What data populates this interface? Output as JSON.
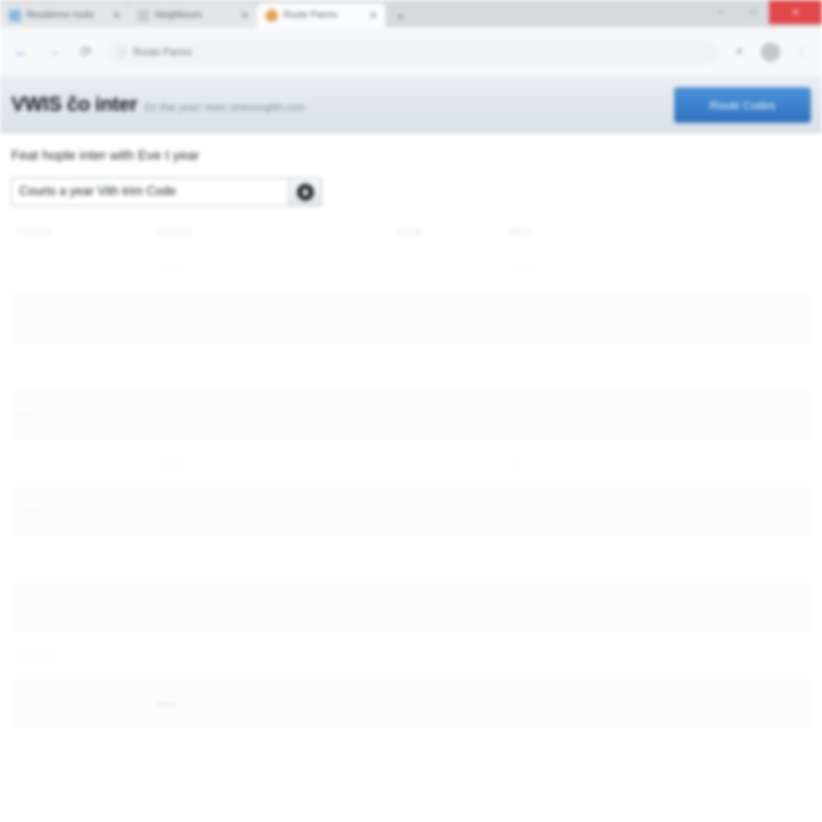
{
  "browser": {
    "tabs": [
      {
        "title": "Residence route",
        "favicon": "globe-favicon",
        "active": false
      },
      {
        "title": "Neighbours",
        "favicon": "page-favicon",
        "active": false
      },
      {
        "title": "Route Parms",
        "favicon": "orange-circle-favicon",
        "active": true
      }
    ],
    "new_tab_label": "+",
    "window_controls": {
      "minimize": "–",
      "maximize": "□",
      "close": "✕"
    },
    "nav": {
      "back": "←",
      "forward": "→",
      "reload": "⟳"
    },
    "omnibox": {
      "lock": "ⓘ",
      "url": "Route Parms"
    },
    "toolbar_right": {
      "extension": "✦",
      "avatar": "profile-avatar",
      "menu": "⋮"
    }
  },
  "page": {
    "brand_title": "VWIS čo inter",
    "brand_subtitle": "En thie year/ vlvim si/revonglith.com",
    "cta_label": "Route Codes",
    "lead": "Feat hople inter with Eve t year",
    "search": {
      "value": "Courts a year Vith trim Code",
      "placeholder": "Courts a year Vith trim Code",
      "go_icon": "location-pin-icon"
    },
    "table": {
      "columns": [
        "Course",
        "Closest",
        "Code",
        "Miles"
      ],
      "rows": [
        {
          "c1": "·",
          "c2": "———",
          "c3": "",
          "c4": "———",
          "alt": false
        },
        {
          "c1": "·",
          "c2": "··",
          "c3": "",
          "c4": "··",
          "alt": true
        },
        {
          "c1": "·",
          "c2": "···",
          "c3": "",
          "c4": "···",
          "alt": false
        },
        {
          "c1": "——",
          "c2": "",
          "c3": "",
          "c4": "",
          "alt": true
        },
        {
          "c1": "·",
          "c2": "———",
          "c3": "·",
          "c4": "— —",
          "alt": false
        },
        {
          "c1": "———",
          "c2": "",
          "c3": "",
          "c4": "··",
          "alt": true
        },
        {
          "c1": "·",
          "c2": "",
          "c3": "",
          "c4": "··",
          "alt": false
        },
        {
          "c1": "·",
          "c2": "",
          "c3": "",
          "c4": "——",
          "alt": true
        },
        {
          "c1": "————",
          "c2": "",
          "c3": "",
          "c4": "",
          "alt": false
        },
        {
          "c1": "·",
          "c2": "——",
          "c3": "",
          "c4": "··",
          "alt": true
        }
      ]
    }
  },
  "colors": {
    "accent_blue": "#2f73bd",
    "header_band": "#dfe6ee",
    "close_red": "#e0484a",
    "link_blue": "#b9cfe4"
  }
}
